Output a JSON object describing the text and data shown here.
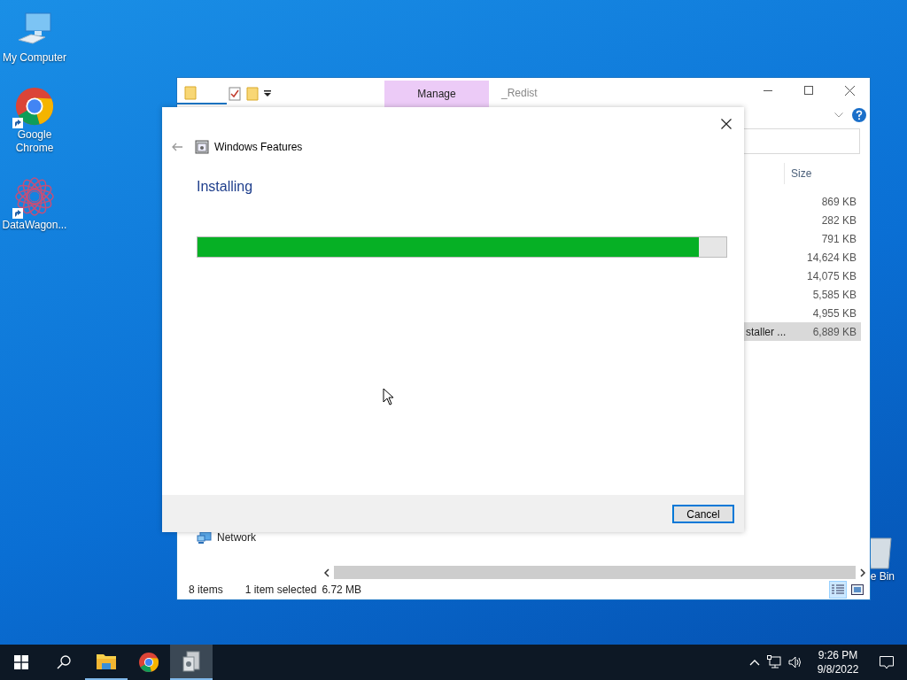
{
  "desktop": {
    "icons": [
      {
        "label": "My Computer",
        "kind": "computer",
        "shortcut": false
      },
      {
        "label": "Google Chrome",
        "kind": "chrome",
        "shortcut": true
      },
      {
        "label": "DataWagon...",
        "kind": "datawagon",
        "shortcut": true
      }
    ],
    "recycle_bin": {
      "label": "e Bin"
    }
  },
  "explorer": {
    "tabs": [
      {
        "label": "Manage",
        "selected": true
      }
    ],
    "title": "_Redist",
    "columns": [
      "Size"
    ],
    "files": [
      {
        "size": "869 KB",
        "selected": false
      },
      {
        "size": "282 KB",
        "selected": false
      },
      {
        "size": "791 KB",
        "selected": false
      },
      {
        "size": "14,624 KB",
        "selected": false
      },
      {
        "size": "14,075 KB",
        "selected": false
      },
      {
        "size": "5,585 KB",
        "selected": false
      },
      {
        "size": "4,955 KB",
        "selected": false
      },
      {
        "name": "staller ...",
        "size": "6,889 KB",
        "selected": true
      }
    ],
    "nav": [
      {
        "label": "Network"
      }
    ],
    "status": {
      "count": "8 items",
      "selection": "1 item selected",
      "size": "6.72 MB"
    },
    "view_buttons": [
      {
        "kind": "details",
        "selected": true
      },
      {
        "kind": "tiles",
        "selected": false
      }
    ]
  },
  "dialog": {
    "title": "Windows Features",
    "heading": "Installing",
    "progress": {
      "level": 0.948
    },
    "buttons": [
      {
        "label": "Cancel",
        "default": true
      }
    ]
  },
  "taskbar": {
    "apps": [
      {
        "kind": "explorer",
        "selected": false,
        "running": true
      },
      {
        "kind": "chrome",
        "selected": false,
        "running": false
      },
      {
        "kind": "features",
        "selected": true,
        "running": true
      }
    ],
    "clock": {
      "time": "9:26 PM",
      "date": "9/8/2022"
    }
  }
}
